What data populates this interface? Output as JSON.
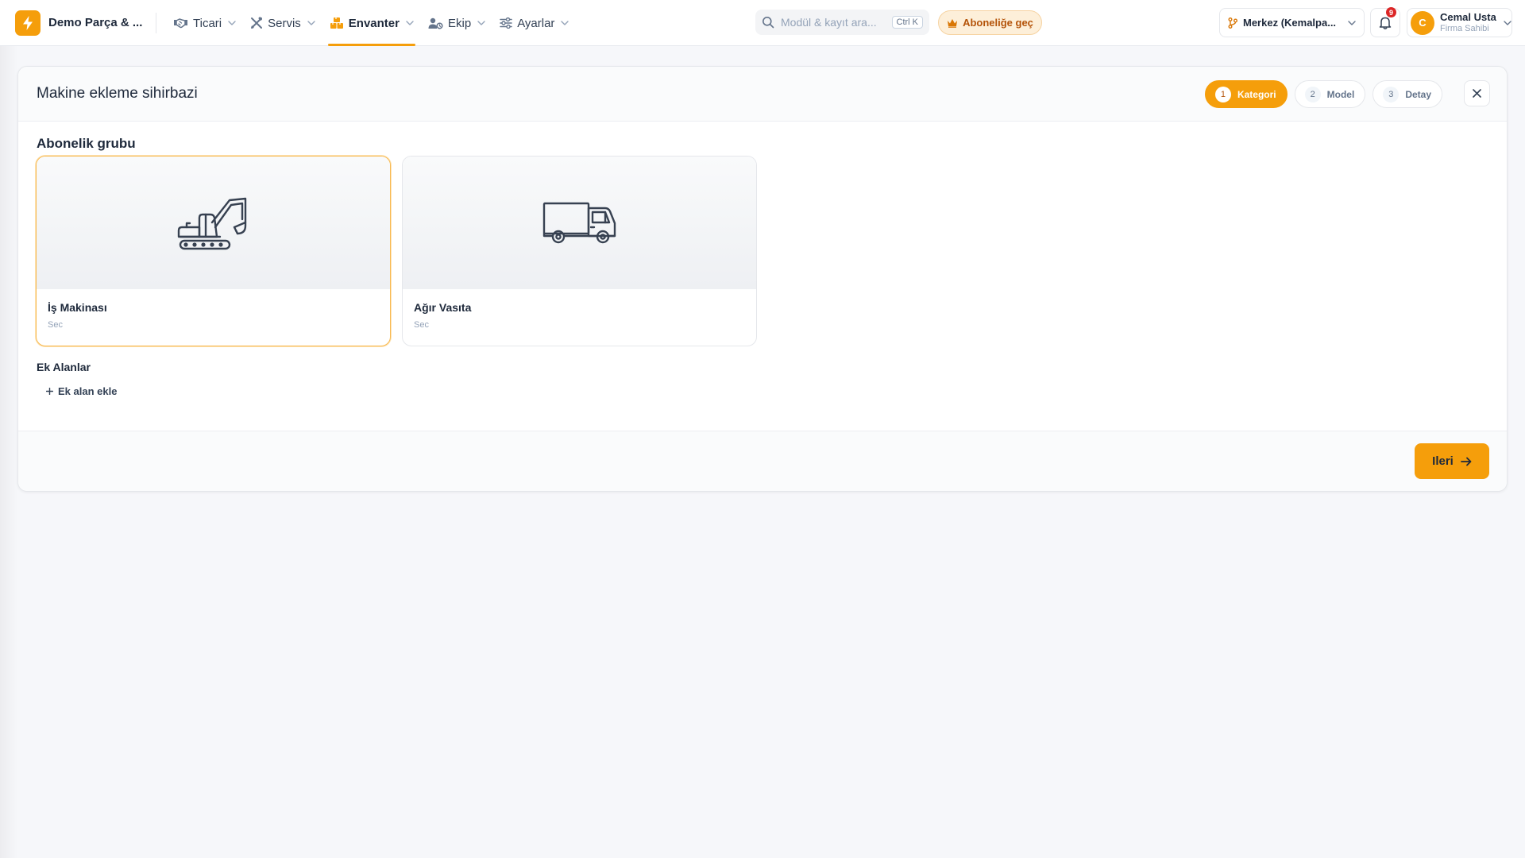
{
  "header": {
    "brand": "Demo Parça & ...",
    "nav": [
      {
        "label": "Ticari",
        "icon": "handshake-icon"
      },
      {
        "label": "Servis",
        "icon": "tools-icon"
      },
      {
        "label": "Envanter",
        "icon": "boxes-icon",
        "active": true
      },
      {
        "label": "Ekip",
        "icon": "team-icon"
      },
      {
        "label": "Ayarlar",
        "icon": "sliders-icon"
      }
    ],
    "search": {
      "placeholder": "Modül & kayıt ara...",
      "shortcut": "Ctrl K"
    },
    "subscribe_label": "Aboneliğe geç",
    "branch_label": "Merkez (Kemalpa...",
    "notifications_count": "9",
    "user": {
      "initial": "C",
      "name": "Cemal Usta",
      "role": "Firma Sahibi"
    }
  },
  "wizard": {
    "title": "Makine ekleme sihirbazi",
    "steps": [
      {
        "num": "1",
        "label": "Kategori",
        "active": true
      },
      {
        "num": "2",
        "label": "Model"
      },
      {
        "num": "3",
        "label": "Detay"
      }
    ],
    "section_title": "Abonelik grubu",
    "options": [
      {
        "name": "İş Makinası",
        "sub": "Sec",
        "icon": "excavator-icon",
        "selected": true
      },
      {
        "name": "Ağır Vasıta",
        "sub": "Sec",
        "icon": "truck-icon",
        "selected": false
      }
    ],
    "extra_title": "Ek Alanlar",
    "add_field_label": "Ek alan ekle",
    "next_label": "Ileri"
  },
  "colors": {
    "accent": "#f59e0b",
    "accent_soft": "#fdefd9",
    "badge": "#dc2626"
  }
}
